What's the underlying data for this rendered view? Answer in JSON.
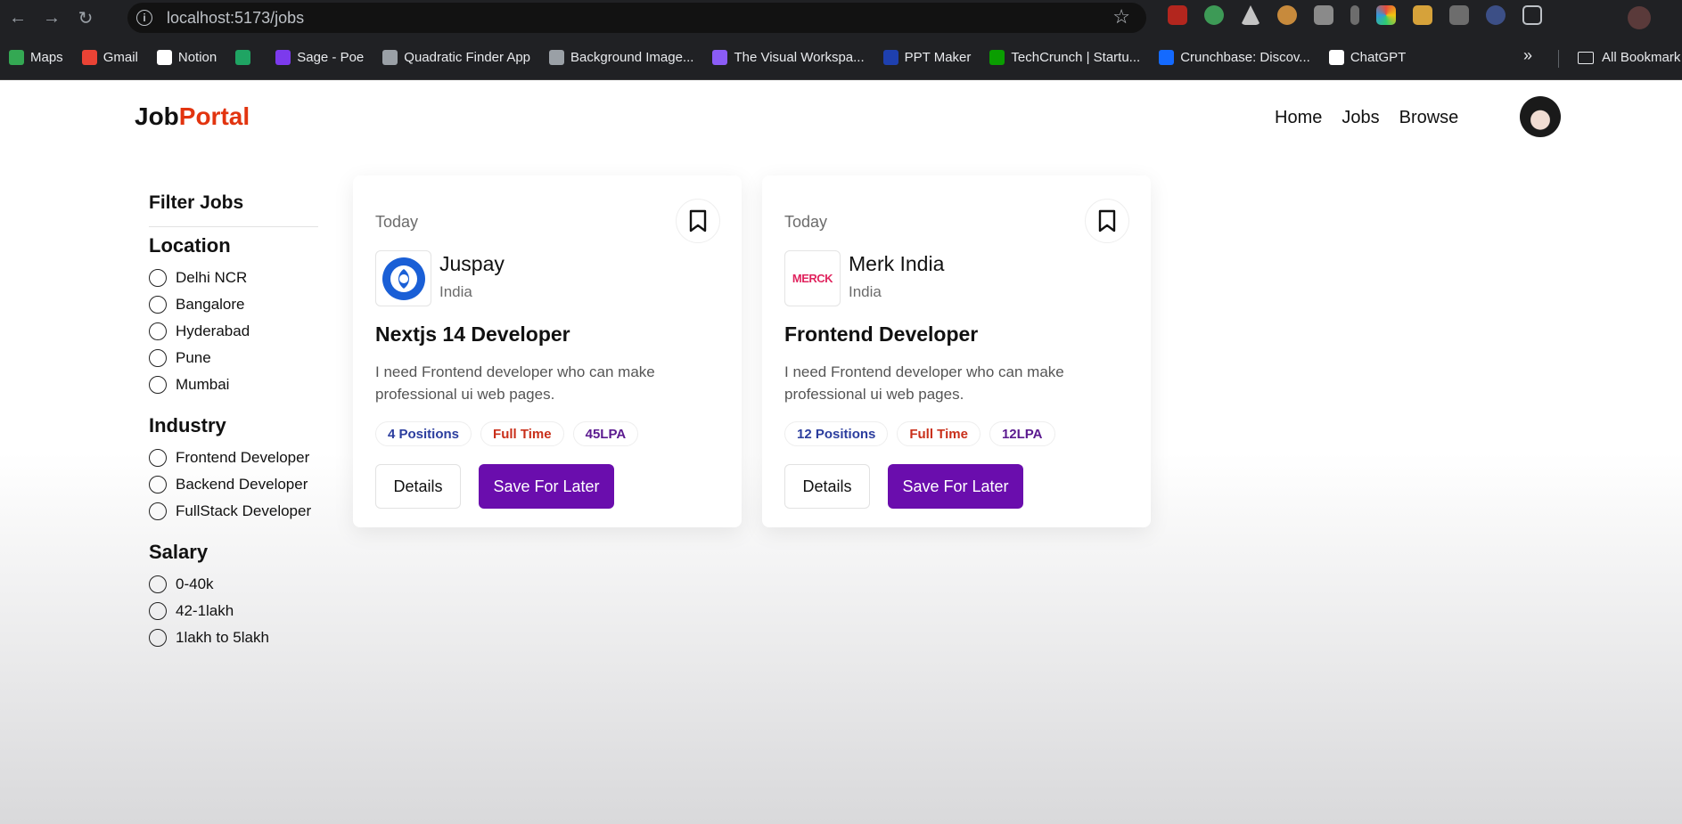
{
  "browser": {
    "url": "localhost:5173/jobs",
    "bookmarks": [
      {
        "label": "Maps",
        "icon": "maps-icon",
        "color": "#34a853"
      },
      {
        "label": "Gmail",
        "icon": "gmail-icon",
        "color": "#ea4335"
      },
      {
        "label": "Notion",
        "icon": "notion-icon",
        "color": "#ffffff"
      },
      {
        "label": "",
        "icon": "app-icon",
        "color": "#1fa463"
      },
      {
        "label": "Sage - Poe",
        "icon": "poe-icon",
        "color": "#7c3aed"
      },
      {
        "label": "Quadratic Finder App",
        "icon": "globe-icon",
        "color": "#9aa0a6"
      },
      {
        "label": "Background Image...",
        "icon": "globe-icon",
        "color": "#9aa0a6"
      },
      {
        "label": "The Visual Workspa...",
        "icon": "workspace-icon",
        "color": "#8b5cf6"
      },
      {
        "label": "PPT Maker",
        "icon": "ppt-icon",
        "color": "#1e40af"
      },
      {
        "label": "TechCrunch | Startu...",
        "icon": "techcrunch-icon",
        "color": "#0a9e01"
      },
      {
        "label": "Crunchbase: Discov...",
        "icon": "crunchbase-icon",
        "color": "#146aff"
      },
      {
        "label": "ChatGPT",
        "icon": "chatgpt-icon",
        "color": "#ffffff"
      }
    ],
    "all_bookmarks": "All Bookmark"
  },
  "header": {
    "logo_main": "Job",
    "logo_accent": "Portal",
    "nav": [
      "Home",
      "Jobs",
      "Browse"
    ]
  },
  "filters": {
    "title": "Filter Jobs",
    "location": {
      "title": "Location",
      "options": [
        "Delhi NCR",
        "Bangalore",
        "Hyderabad",
        "Pune",
        "Mumbai"
      ]
    },
    "industry": {
      "title": "Industry",
      "options": [
        "Frontend Developer",
        "Backend Developer",
        "FullStack Developer"
      ]
    },
    "salary": {
      "title": "Salary",
      "options": [
        "0-40k",
        "42-1lakh",
        "1lakh to 5lakh"
      ]
    }
  },
  "jobs": [
    {
      "date": "Today",
      "company": "Juspay",
      "country": "India",
      "title": "Nextjs 14 Developer",
      "description": "I need Frontend developer who can make professional ui web pages.",
      "positions": "4 Positions",
      "type": "Full Time",
      "salary": "45LPA",
      "details_label": "Details",
      "save_label": "Save For Later"
    },
    {
      "date": "Today",
      "company": "Merk India",
      "country": "India",
      "title": "Frontend Developer",
      "description": "I need Frontend developer who can make professional ui web pages.",
      "positions": "12 Positions",
      "type": "Full Time",
      "salary": "12LPA",
      "details_label": "Details",
      "save_label": "Save For Later",
      "logo_text": "MERCK"
    }
  ],
  "colors": {
    "accent": "#e2340f",
    "primary_button": "#6a0dad"
  }
}
